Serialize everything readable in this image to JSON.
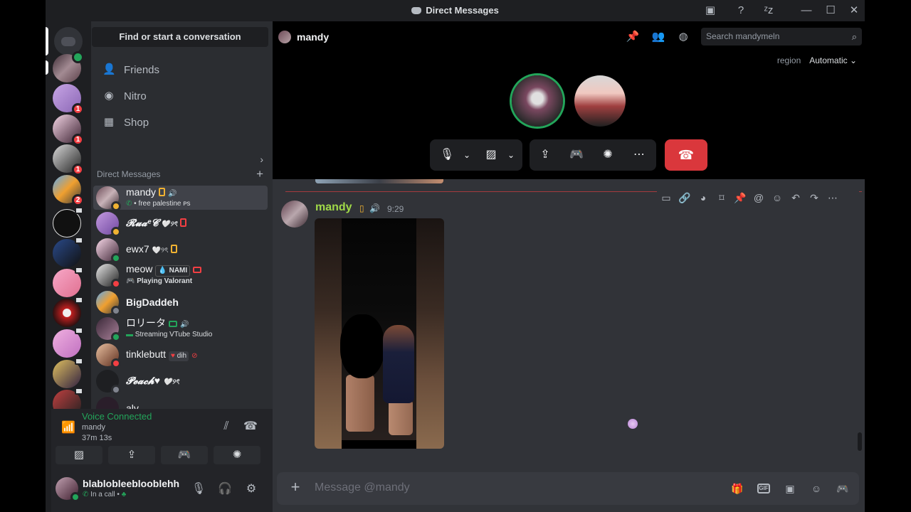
{
  "window": {
    "title": "Direct Messages"
  },
  "sidebar": {
    "search_label": "Find or start a conversation",
    "nav": [
      {
        "label": "Friends",
        "icon": "friends-icon"
      },
      {
        "label": "Nitro",
        "icon": "nitro-icon"
      },
      {
        "label": "Shop",
        "icon": "shop-icon"
      }
    ],
    "dm_header": "Direct Messages",
    "dms": [
      {
        "name": "mandy",
        "sub": "• free palestine ᴘs",
        "status": "#f0b232"
      },
      {
        "name": "𝓡𝓾𝓪ᵉ𝓒",
        "tag": "🤍୨ৎ",
        "status": "#f0b232"
      },
      {
        "name": "ewx7",
        "tag": "🤍୨ৎ",
        "status": "#23a55a"
      },
      {
        "name": "meow",
        "tag": "NAMI",
        "sub": "Playing Valorant",
        "status": "#f23f43"
      },
      {
        "name": "BigDaddeh",
        "status": "#80848e"
      },
      {
        "name": "ロリータ",
        "sub": "Streaming VTube Studio",
        "status": "#23a55a"
      },
      {
        "name": "tinklebutt",
        "tag": "dih",
        "status": "#f23f43"
      },
      {
        "name": "𝓟𝓮𝓪𝓬𝓱♥",
        "tag": "🤍୨ৎ",
        "status": "#80848e"
      },
      {
        "name": "aly",
        "status": "#80848e"
      }
    ]
  },
  "servers": {
    "badges": [
      "1",
      "1",
      "1",
      "2"
    ]
  },
  "voice": {
    "status": "Voice Connected",
    "channel": "mandy",
    "elapsed": "37m 13s"
  },
  "user": {
    "name": "blablobleeblooblehh",
    "sub": "In a call •"
  },
  "chat": {
    "recipient": "mandy",
    "search_placeholder": "Search mandymeln",
    "region_label": "region",
    "region_value": "Automatic",
    "message": {
      "author": "mandy",
      "time": "9:29"
    },
    "composer_placeholder": "Message @mandy"
  },
  "colors": {
    "online": "#23a55a",
    "idle": "#f0b232",
    "dnd": "#f23f43",
    "author": "#a0d948",
    "hangup": "#da373c"
  }
}
